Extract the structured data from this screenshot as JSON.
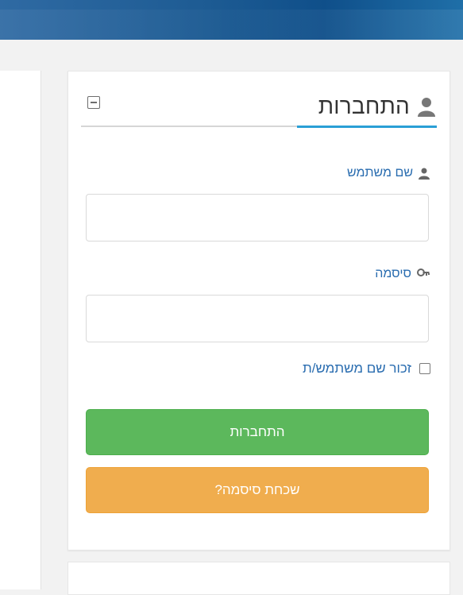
{
  "header": {
    "title": "התחברות",
    "user_icon": "user-icon",
    "minimize_icon": "minimize-icon"
  },
  "form": {
    "username": {
      "label": "שם משתמש",
      "icon": "user-icon",
      "value": "",
      "placeholder": ""
    },
    "password": {
      "label": "סיסמה",
      "icon": "key-icon",
      "value": "",
      "placeholder": ""
    },
    "remember": {
      "label": "זכור שם משתמש/ת",
      "checked": false
    },
    "login_button": "התחברות",
    "forgot_button": "שכחת סיסמה?"
  },
  "colors": {
    "accent": "#2a9fd6",
    "login_green": "#5cb85c",
    "forgot_orange": "#f0ad4e",
    "label_blue": "#2a6db0",
    "topbar": "#1d5b93"
  }
}
